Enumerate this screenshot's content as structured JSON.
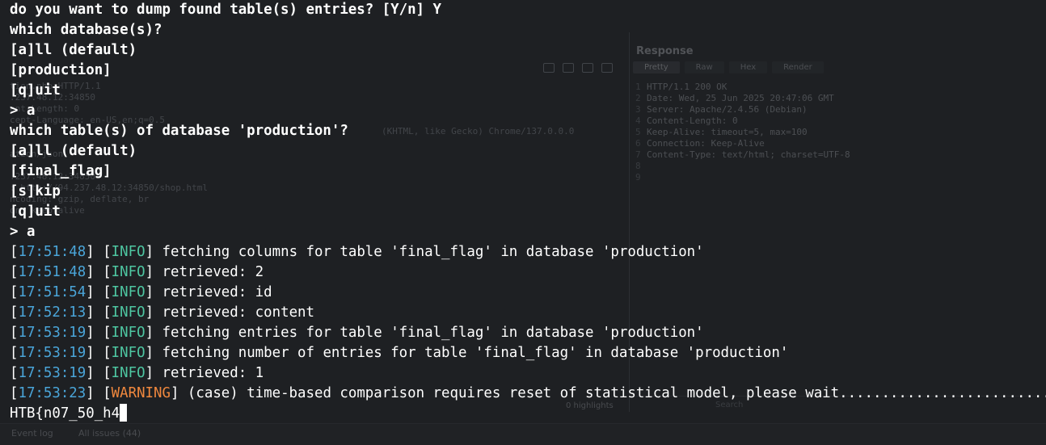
{
  "background": {
    "request_lines": [
      "tion.php HTTP/1.1",
      ".237.48.12:34850",
      "ent-Length: 0",
      "cept-Language: en-US,en;q=0.5",
      "(KHTML, like Gecko) Chrome/137.0.0.0",
      "ation/json",
      ".237.48.12:34850",
      ": http://94.237.48.12:34850/shop.html",
      "ncoding: gzip, deflate, br",
      "on: keep-alive"
    ],
    "response_title": "Response",
    "response_tabs": [
      "Pretty",
      "Raw",
      "Hex",
      "Render"
    ],
    "response_lines": [
      "HTTP/1.1 200 OK",
      "Date: Wed, 25 Jun 2025 20:47:06 GMT",
      "Server: Apache/2.4.56 (Debian)",
      "Content-Length: 0",
      "Keep-Alive: timeout=5, max=100",
      "Connection: Keep-Alive",
      "Content-Type: text/html; charset=UTF-8",
      "",
      ""
    ],
    "response_line_numbers": [
      "1",
      "2",
      "3",
      "4",
      "5",
      "6",
      "7",
      "8",
      "9"
    ],
    "highlights": "0 highlights",
    "search_placeholder": "Search",
    "event_log": "Event log",
    "all_issues": "All issues (44)"
  },
  "terminal": {
    "prompt_lines": [
      "do you want to dump found table(s) entries? [Y/n] Y",
      "which database(s)?",
      "[a]ll (default)",
      "[production]",
      "[q]uit",
      "> a",
      "which table(s) of database 'production'?",
      "[a]ll (default)",
      "[final_flag]",
      "[s]kip",
      "[q]uit",
      "> a"
    ],
    "log_lines": [
      {
        "time": "17:51:48",
        "level": "INFO",
        "message": "fetching columns for table 'final_flag' in database 'production'"
      },
      {
        "time": "17:51:48",
        "level": "INFO",
        "message": "retrieved: 2"
      },
      {
        "time": "17:51:54",
        "level": "INFO",
        "message": "retrieved: id"
      },
      {
        "time": "17:52:13",
        "level": "INFO",
        "message": "retrieved: content"
      },
      {
        "time": "17:53:19",
        "level": "INFO",
        "message": "fetching entries for table 'final_flag' in database 'production'"
      },
      {
        "time": "17:53:19",
        "level": "INFO",
        "message": "fetching number of entries for table 'final_flag' in database 'production'"
      },
      {
        "time": "17:53:19",
        "level": "INFO",
        "message": "retrieved: 1"
      },
      {
        "time": "17:53:23",
        "level": "WARNING",
        "message": "(case) time-based comparison requires reset of statistical model, please wait.............................."
      }
    ],
    "output_line": "HTB{n07_50_h4"
  },
  "colors": {
    "background": "#1e2023",
    "text": "#ffffff",
    "timestamp": "#4aa5d9",
    "info": "#4ec7a2",
    "warning": "#f0883e"
  }
}
